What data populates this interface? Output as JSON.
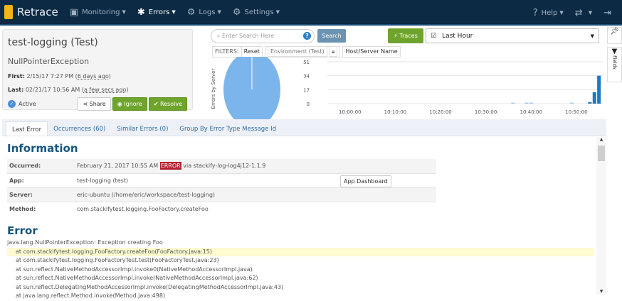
{
  "nav": {
    "brand": "Retrace",
    "items": [
      {
        "label": "Monitoring",
        "icon": "monitor-icon"
      },
      {
        "label": "Errors",
        "icon": "bug-icon"
      },
      {
        "label": "Logs",
        "icon": "logs-icon"
      },
      {
        "label": "Settings",
        "icon": "gear-icon"
      }
    ],
    "help": "Help"
  },
  "panel": {
    "title": "test-logging (Test)",
    "exception": "NullPointerException",
    "first_label": "First:",
    "first_value": "2/15/17 7:27 PM",
    "first_rel": "6 days ago",
    "last_label": "Last:",
    "last_value": "02/21/17 10:56 AM",
    "last_rel": "a few secs ago",
    "status": "Active",
    "share": "Share",
    "ignore": "Ignore",
    "resolve": "Resolve"
  },
  "search": {
    "placeholder": "Enter Search Here",
    "button": "Search"
  },
  "traces": "Traces",
  "time_range": "Last Hour",
  "filters": {
    "label": "FILTERS:",
    "reset": "Reset",
    "environment": "Environment (Test)",
    "host": "Host/Server Name"
  },
  "sidebar": {
    "fields": "Fields"
  },
  "chart_data": [
    {
      "type": "pie",
      "title": "Errors by Server",
      "values": [
        100
      ],
      "color": "#7cb5ec"
    },
    {
      "type": "bar",
      "color": "#1f78c1",
      "yticks": [
        0,
        17,
        34,
        51
      ],
      "ylim": [
        0,
        51
      ],
      "xticks": [
        "10:00:00",
        "10:10:00",
        "10:20:00",
        "10:30:00",
        "10:40:00",
        "10:50:00"
      ],
      "xrange_min": [
        -5,
        56
      ],
      "points": [
        {
          "min": 36,
          "v": 1
        },
        {
          "min": 39,
          "v": 1
        },
        {
          "min": 40,
          "v": 1
        },
        {
          "min": 49,
          "v": 1
        },
        {
          "min": 53,
          "v": 2
        },
        {
          "min": 54,
          "v": 14
        },
        {
          "min": 55,
          "v": 34
        }
      ]
    }
  ],
  "tabs": [
    "Last Error",
    "Occurrences (60)",
    "Similar Errors (0)",
    "Group By Error Type Message Id"
  ],
  "info": {
    "heading": "Information",
    "rows": [
      {
        "k": "Occurred:",
        "v": "February 21, 2017 10:55 AM",
        "badge": "ERROR",
        "suffix": "via stackify-log-log4j12-1.1.9"
      },
      {
        "k": "App:",
        "v": "test-logging (test)",
        "button": "App Dashboard"
      },
      {
        "k": "Server:",
        "v": "eric-ubuntu (/home/eric/workspace/test-logging)"
      },
      {
        "k": "Method:",
        "v": "com.stackifytest.logging.FooFactory.createFoo"
      }
    ]
  },
  "error": {
    "heading": "Error",
    "message": "java.lang.NullPointerException: Exception creating Foo",
    "frames": [
      "at com.stackifytest.logging.FooFactory.createFoo(FooFactory.java:15)",
      "at com.stackifytest.logging.FooFactoryTest.test(FooFactoryTest.java:23)",
      "at sun.reflect.NativeMethodAccessorImpl.invoke0(NativeMethodAccessorImpl.java)",
      "at sun.reflect.NativeMethodAccessorImpl.invoke(NativeMethodAccessorImpl.java:62)",
      "at sun.reflect.DelegatingMethodAccessorImpl.invoke(DelegatingMethodAccessorImpl.java:43)",
      "at java.lang.reflect.Method.invoke(Method.java:498)"
    ]
  }
}
